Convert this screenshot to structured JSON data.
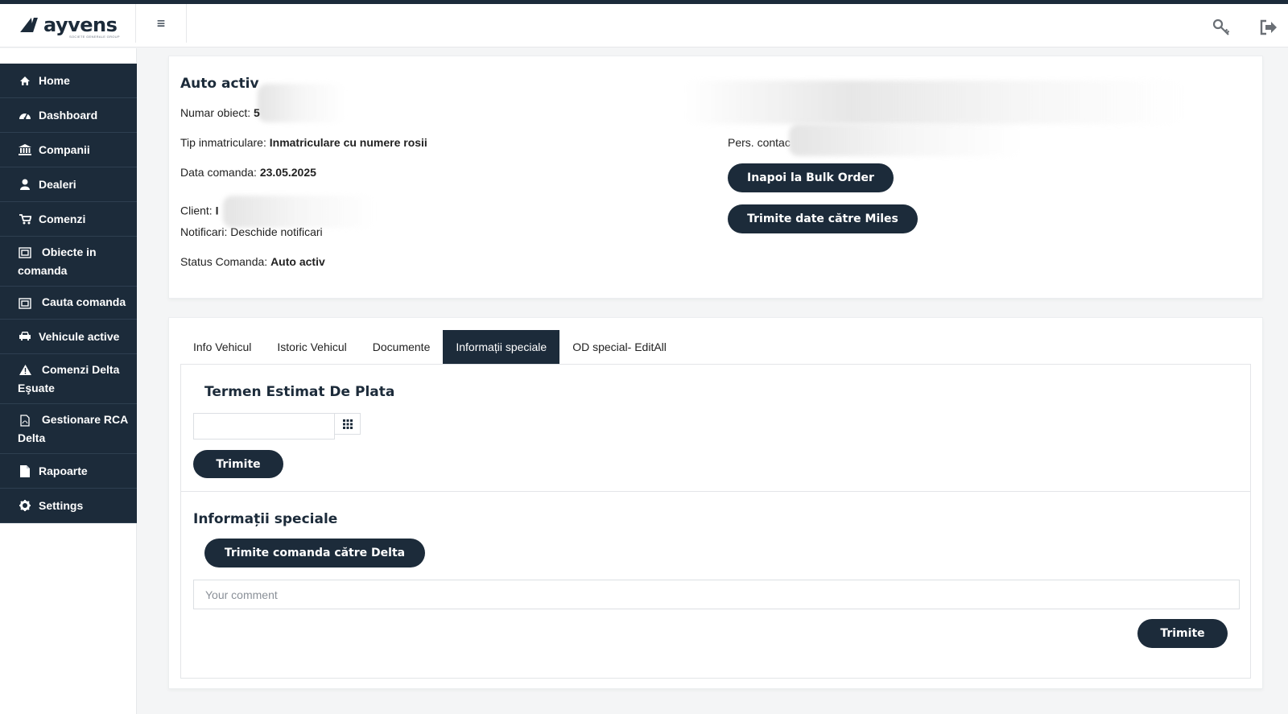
{
  "header": {
    "logo_text": "ayvens",
    "logo_sub": "SOCIETE GENERALE GROUP",
    "menu_icon": "hamburger-icon",
    "key_icon": "key-icon",
    "logout_icon": "logout-icon"
  },
  "sidebar": {
    "items": [
      {
        "label": "Home",
        "icon": "home-icon"
      },
      {
        "label": "Dashboard",
        "icon": "dashboard-icon"
      },
      {
        "label": "Companii",
        "icon": "bank-icon"
      },
      {
        "label": "Dealeri",
        "icon": "user-icon"
      },
      {
        "label": "Comenzi",
        "icon": "cart-icon"
      },
      {
        "label": "Obiecte in comanda",
        "icon": "object-icon"
      },
      {
        "label": "Cauta comanda",
        "icon": "object-icon"
      },
      {
        "label": "Vehicule active",
        "icon": "car-icon"
      },
      {
        "label": "Comenzi Delta Eşuate",
        "icon": "warning-icon"
      },
      {
        "label": "Gestionare RCA Delta",
        "icon": "pdf-file-icon"
      },
      {
        "label": "Rapoarte",
        "icon": "file-icon"
      },
      {
        "label": "Settings",
        "icon": "gear-icon"
      }
    ]
  },
  "order": {
    "title": "Auto activ",
    "numar_obiect_label": "Numar obiect:",
    "numar_obiect_value": "5",
    "tip_label": "Tip inmatriculare:",
    "tip_value": "Inmatriculare cu numere rosii",
    "data_label": "Data comanda:",
    "data_value": "23.05.2025",
    "client_label": "Client:",
    "client_value": "I",
    "notificari_label": "Notificari:",
    "notificari_link": "Deschide notificari",
    "status_label": "Status Comanda:",
    "status_value": "Auto activ",
    "pers_contact_label": "Pers. contac",
    "btn_bulk": "Inapoi la Bulk Order",
    "btn_miles": "Trimite date către Miles"
  },
  "tabs": [
    {
      "label": "Info Vehicul",
      "active": false
    },
    {
      "label": "Istoric Vehicul",
      "active": false
    },
    {
      "label": "Documente",
      "active": false
    },
    {
      "label": "Informații speciale",
      "active": true
    },
    {
      "label": "OD special- EditAll",
      "active": false
    }
  ],
  "pane": {
    "termen_title": "Termen Estimat De Plata",
    "date_value": "",
    "calendar_icon": "calendar-grid-icon",
    "trimite_1": "Trimite",
    "info_title": "Informații speciale",
    "btn_delta": "Trimite comanda către Delta",
    "comment_placeholder": "Your comment",
    "comment_value": "",
    "trimite_2": "Trimite"
  },
  "colors": {
    "navy": "#1c2b3a",
    "background": "#f4f5f6"
  }
}
